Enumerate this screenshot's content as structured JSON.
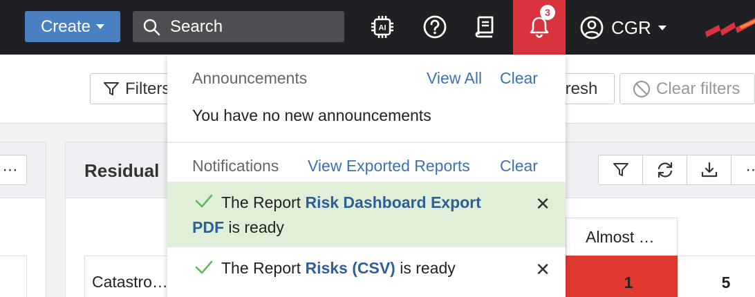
{
  "topbar": {
    "create_label": "Create",
    "search_placeholder": "Search",
    "notification_count": "3",
    "user_label": "CGR"
  },
  "filterbar": {
    "filters_label": "Filters",
    "refresh_label": "fresh",
    "clear_filters_label": "Clear filters"
  },
  "panel": {
    "title": "Residual",
    "column_header": "Almost …",
    "row_label": "Catastro…",
    "red_cell_value": "1",
    "cell_value": "5"
  },
  "dropdown": {
    "announcements_title": "Announcements",
    "announcements_view_all": "View All",
    "announcements_clear": "Clear",
    "announcements_empty": "You have no new announcements",
    "notifications_title": "Notifications",
    "notifications_view_exported": "View Exported Reports",
    "notifications_clear": "Clear",
    "items": [
      {
        "prefix": "The Report ",
        "name_line1": "Risk Dashboard Export",
        "name_line2": "PDF",
        "suffix": " is ready"
      },
      {
        "prefix": "The Report ",
        "name": "Risks (CSV)",
        "suffix": " is ready"
      }
    ]
  },
  "colors": {
    "topbar_bg": "#1f2023",
    "create_blue": "#4a7fc1",
    "bell_red": "#d9343d",
    "link_blue": "#3a72b5",
    "success_bg": "#dfefd8",
    "risk_red": "#e03a30"
  }
}
